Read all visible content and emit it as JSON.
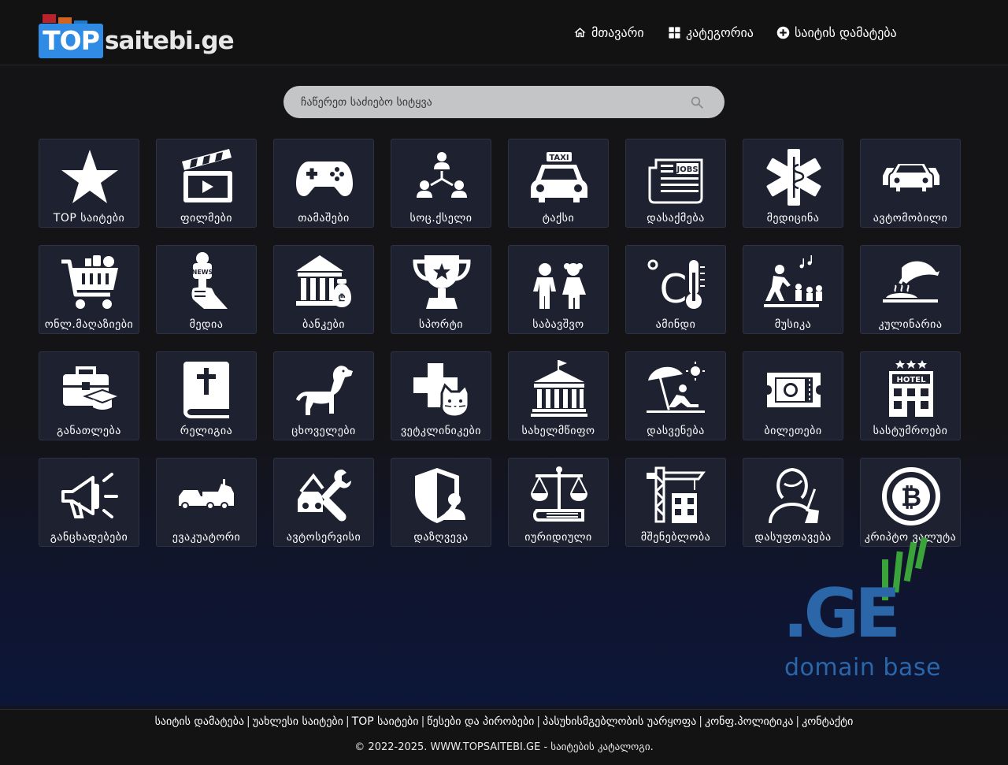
{
  "logo": {
    "top": "TOP",
    "rest": "saitebi.ge"
  },
  "nav": [
    {
      "label": "მთავარი",
      "icon": "home-icon"
    },
    {
      "label": "კატეგორია",
      "icon": "grid-icon"
    },
    {
      "label": "საიტის დამატება",
      "icon": "plus-circle-icon"
    }
  ],
  "search": {
    "placeholder": "ჩაწერეთ საძიებო სიტყვა",
    "icon": "search-icon"
  },
  "categories": [
    {
      "label": "TOP საიტები",
      "icon": "star-icon"
    },
    {
      "label": "ფილმები",
      "icon": "clapperboard-icon"
    },
    {
      "label": "თამაშები",
      "icon": "gamepad-icon"
    },
    {
      "label": "სოც.ქსელი",
      "icon": "social-network-icon"
    },
    {
      "label": "ტაქსი",
      "icon": "taxi-icon"
    },
    {
      "label": "დასაქმება",
      "icon": "jobs-newspaper-icon"
    },
    {
      "label": "მედიცინა",
      "icon": "medical-star-icon"
    },
    {
      "label": "ავტომობილი",
      "icon": "cars-icon"
    },
    {
      "label": "ონლ.მაღაზიები",
      "icon": "shopping-cart-icon"
    },
    {
      "label": "მედია",
      "icon": "news-microphone-icon"
    },
    {
      "label": "ბანკები",
      "icon": "bank-icon"
    },
    {
      "label": "სპორტი",
      "icon": "trophy-icon"
    },
    {
      "label": "საბავშვო",
      "icon": "children-icon"
    },
    {
      "label": "ამინდი",
      "icon": "thermometer-icon"
    },
    {
      "label": "მუსიკა",
      "icon": "music-dance-icon"
    },
    {
      "label": "კულინარია",
      "icon": "cloche-icon"
    },
    {
      "label": "განათლება",
      "icon": "briefcase-graduation-icon"
    },
    {
      "label": "რელიგია",
      "icon": "bible-icon"
    },
    {
      "label": "ცხოველები",
      "icon": "dog-icon"
    },
    {
      "label": "ვეტკლინიკები",
      "icon": "vet-cross-cat-icon"
    },
    {
      "label": "სახელმწიფო",
      "icon": "government-building-icon"
    },
    {
      "label": "დასვენება",
      "icon": "beach-umbrella-icon"
    },
    {
      "label": "ბილეთები",
      "icon": "ticket-icon"
    },
    {
      "label": "სასტუმროები",
      "icon": "hotel-icon"
    },
    {
      "label": "განცხადებები",
      "icon": "megaphone-icon"
    },
    {
      "label": "ევაკუატორი",
      "icon": "tow-truck-icon"
    },
    {
      "label": "ავტოსერვისი",
      "icon": "car-wrench-icon"
    },
    {
      "label": "დაზღვევა",
      "icon": "insurance-shield-icon"
    },
    {
      "label": "იურიდიული",
      "icon": "scales-icon"
    },
    {
      "label": "მშენებლობა",
      "icon": "construction-crane-icon"
    },
    {
      "label": "დასუფთავება",
      "icon": "cleaning-woman-icon"
    },
    {
      "label": "კრიპტო ვალუტა",
      "icon": "bitcoin-icon"
    }
  ],
  "domain_logo": {
    "mark": ".GE",
    "caption": "domain base"
  },
  "footer": {
    "links": [
      "საიტის დამატება",
      "უახლესი საიტები",
      "TOP საიტები",
      "წესები და პირობები",
      "პასუხისმგებლობის უარყოფა",
      "კონფ.პოლიტიკა",
      "კონტაქტი"
    ],
    "copyright": "© 2022-2025. WWW.TOPSAITEBI.GE - საიტების კატალოგი."
  },
  "colors": {
    "tile_bg": "#1e2130",
    "logo_blue": "#2f8be3",
    "ge_blue": "#2a66a8",
    "ge_green": "#3aa43a"
  }
}
